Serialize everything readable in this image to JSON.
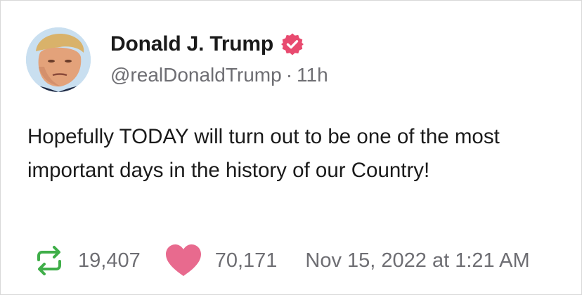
{
  "post": {
    "display_name": "Donald J. Trump",
    "handle": "@realDonaldTrump",
    "separator": "·",
    "age": "11h",
    "text": "Hopefully TODAY will turn out to be one of the most important days in the history of our Country!",
    "reposts": "19,407",
    "likes": "70,171",
    "timestamp": "Nov 15, 2022 at 1:21 AM"
  },
  "icons": {
    "verified": "verified-badge-icon",
    "repost": "repost-icon",
    "like": "heart-icon"
  },
  "colors": {
    "verified_badge": "#e84a6f",
    "repost_icon": "#3fae49",
    "like_icon": "#e86a8e",
    "secondary_text": "#6e6e73",
    "primary_text": "#1a1a1a"
  }
}
